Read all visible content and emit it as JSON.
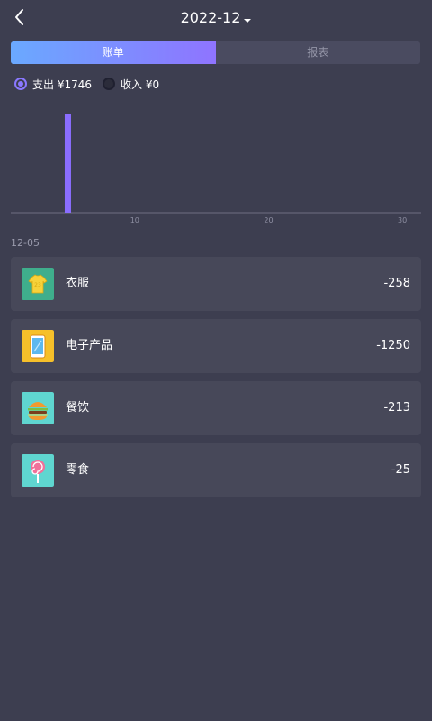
{
  "header": {
    "month": "2022-12"
  },
  "tabs": [
    {
      "label": "账单",
      "active": true
    },
    {
      "label": "报表",
      "active": false
    }
  ],
  "filters": {
    "expense": {
      "label": "支出 ¥1746",
      "selected": true
    },
    "income": {
      "label": "收入 ¥0",
      "selected": false
    }
  },
  "chart_data": {
    "type": "bar",
    "x": [
      5
    ],
    "values": [
      1746
    ],
    "xlim": [
      1,
      31
    ],
    "xticks": [
      "10",
      "20",
      "30"
    ],
    "bar_color": "#8a6dff"
  },
  "list": {
    "date": "12-05",
    "items": [
      {
        "name": "衣服",
        "amount": "-258",
        "icon": "shirt-icon"
      },
      {
        "name": "电子产品",
        "amount": "-1250",
        "icon": "phone-icon"
      },
      {
        "name": "餐饮",
        "amount": "-213",
        "icon": "burger-icon"
      },
      {
        "name": "零食",
        "amount": "-25",
        "icon": "lollipop-icon"
      }
    ]
  },
  "colors": {
    "background": "#3d3e50",
    "card": "#474859",
    "accent": "#8a78ff"
  }
}
